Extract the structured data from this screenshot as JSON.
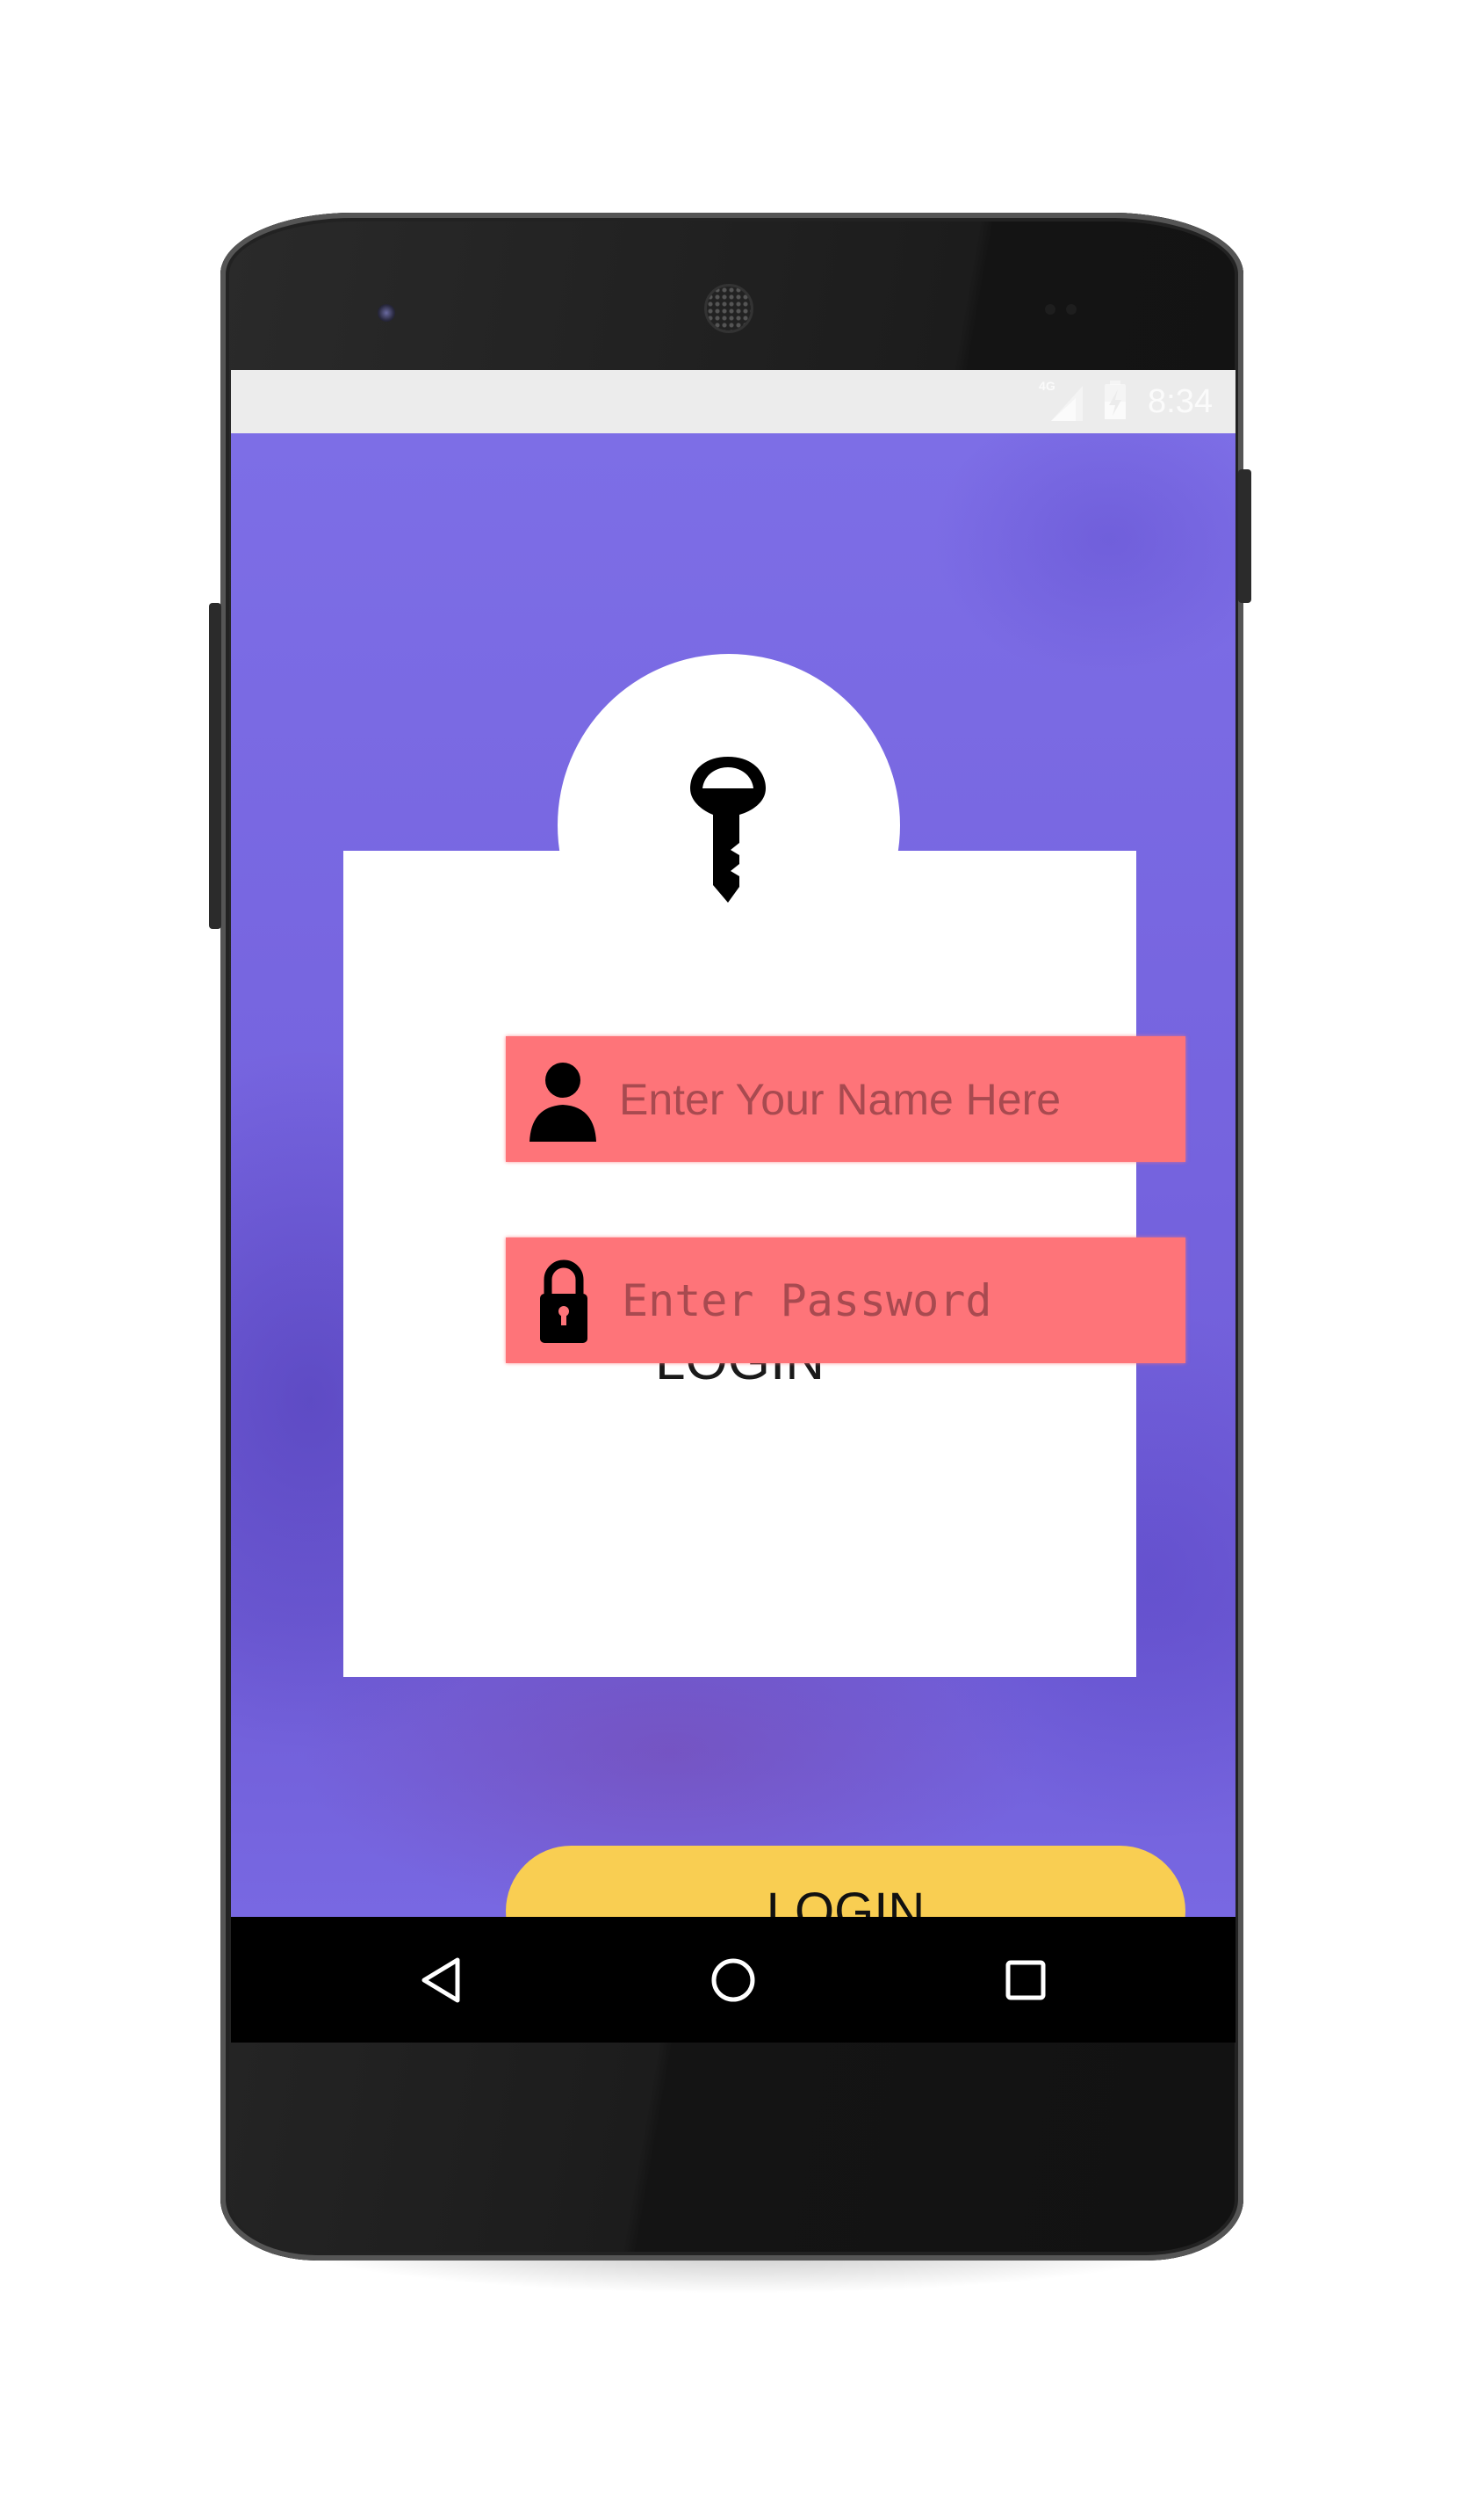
{
  "status_bar": {
    "network": "4G",
    "time": "8:34",
    "icons": [
      "signal-icon",
      "battery-charging-icon"
    ]
  },
  "login_card": {
    "icon": "key-icon",
    "title": "LOGIN",
    "username_field": {
      "icon": "user-icon",
      "placeholder": "Enter Your Name Here",
      "value": ""
    },
    "password_field": {
      "icon": "lock-icon",
      "placeholder": "Enter Password",
      "value": ""
    },
    "login_button": "LOGIN"
  },
  "nav_bar": {
    "icons": [
      "back-icon",
      "home-icon",
      "recents-icon"
    ]
  },
  "colors": {
    "background": "#7b6ae4",
    "field": "#fe7479",
    "button": "#f9ce52",
    "card": "#ffffff"
  }
}
